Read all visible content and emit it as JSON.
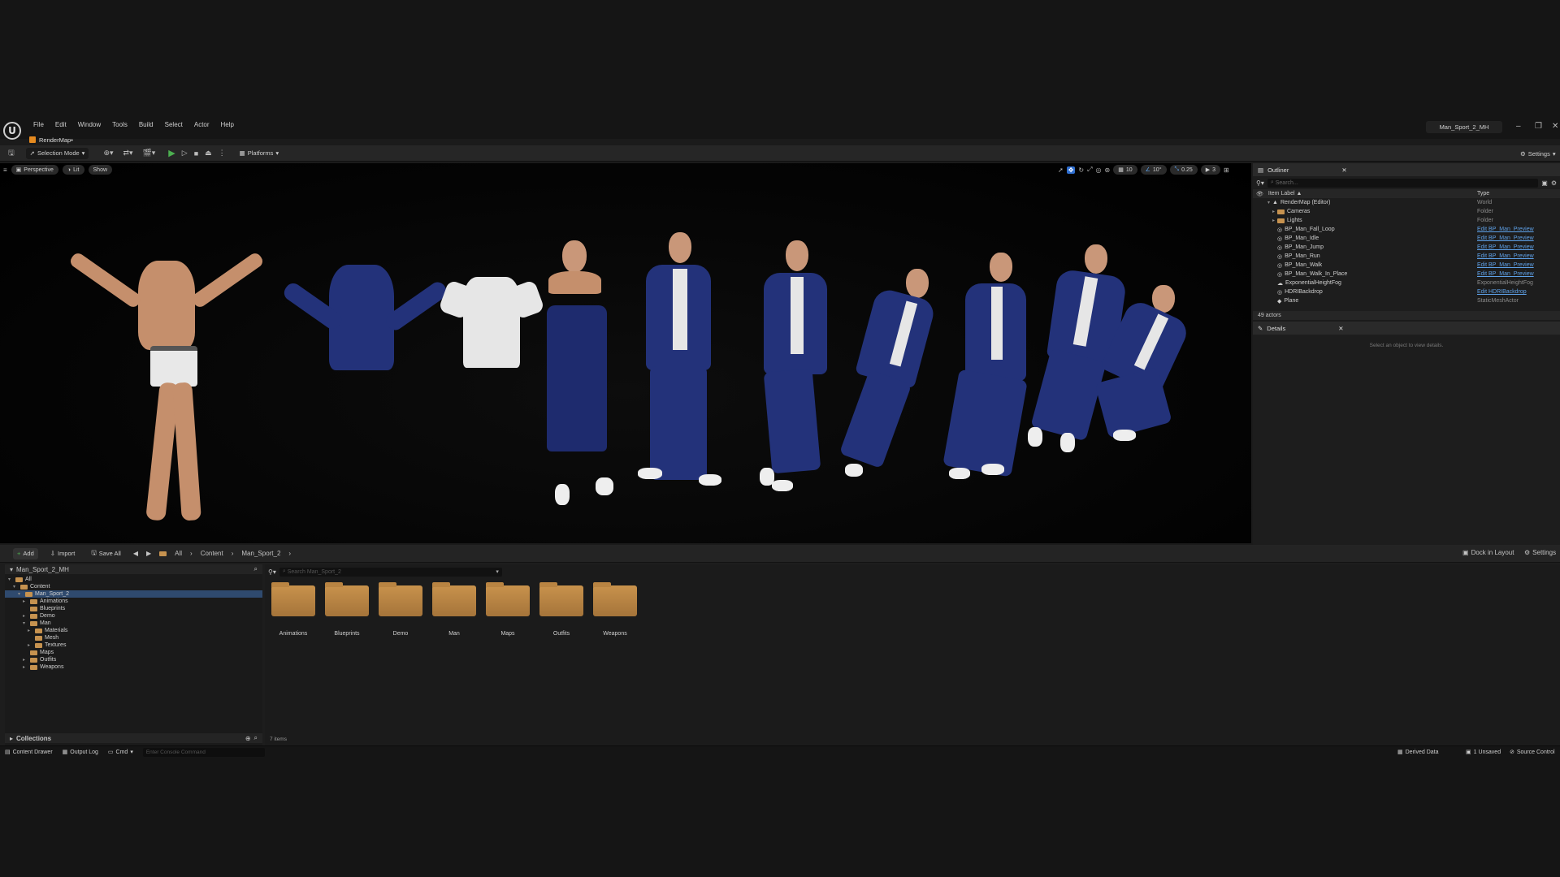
{
  "menubar": {
    "items": [
      "File",
      "Edit",
      "Window",
      "Tools",
      "Build",
      "Select",
      "Actor",
      "Help"
    ],
    "project_title": "Man_Sport_2_MH"
  },
  "document_tab": {
    "label": "RenderMap•"
  },
  "toolbar": {
    "selection_mode": "Selection Mode",
    "platforms": "Platforms",
    "settings": "Settings"
  },
  "viewport": {
    "perspective": "Perspective",
    "lit": "Lit",
    "show": "Show",
    "grid_snap": "10",
    "rotation_snap": "10°",
    "scale_snap": "0.25",
    "camera_speed": "3"
  },
  "outliner": {
    "tab": "Outliner",
    "search_placeholder": "Search...",
    "col_label": "Item Label ▲",
    "col_type": "Type",
    "rows": [
      {
        "label": "RenderMap (Editor)",
        "type": "World"
      },
      {
        "label": "Cameras",
        "type": "Folder"
      },
      {
        "label": "Lights",
        "type": "Folder"
      },
      {
        "label": "BP_Man_Fall_Loop",
        "type": "Edit BP_Man_Preview"
      },
      {
        "label": "BP_Man_Idle",
        "type": "Edit BP_Man_Preview"
      },
      {
        "label": "BP_Man_Jump",
        "type": "Edit BP_Man_Preview"
      },
      {
        "label": "BP_Man_Run",
        "type": "Edit BP_Man_Preview"
      },
      {
        "label": "BP_Man_Walk",
        "type": "Edit BP_Man_Preview"
      },
      {
        "label": "BP_Man_Walk_In_Place",
        "type": "Edit BP_Man_Preview"
      },
      {
        "label": "ExponentialHeightFog",
        "type": "ExponentialHeightFog"
      },
      {
        "label": "HDRIBackdrop",
        "type": "Edit HDRIBackdrop"
      },
      {
        "label": "Plane",
        "type": "StaticMeshActor"
      }
    ],
    "actor_count": "49 actors"
  },
  "details": {
    "tab": "Details",
    "empty_text": "Select an object to view details."
  },
  "content_browser": {
    "add": "Add",
    "import": "Import",
    "save_all": "Save All",
    "path": [
      "All",
      "Content",
      "Man_Sport_2"
    ],
    "dock": "Dock in Layout",
    "settings": "Settings",
    "tree_header": "Man_Sport_2_MH",
    "tree": [
      {
        "label": "All",
        "depth": 0
      },
      {
        "label": "Content",
        "depth": 1
      },
      {
        "label": "Man_Sport_2",
        "depth": 2
      },
      {
        "label": "Animations",
        "depth": 3
      },
      {
        "label": "Blueprints",
        "depth": 3
      },
      {
        "label": "Demo",
        "depth": 3
      },
      {
        "label": "Man",
        "depth": 3
      },
      {
        "label": "Materials",
        "depth": 4
      },
      {
        "label": "Mesh",
        "depth": 4
      },
      {
        "label": "Textures",
        "depth": 4
      },
      {
        "label": "Maps",
        "depth": 3
      },
      {
        "label": "Outfits",
        "depth": 3
      },
      {
        "label": "Weapons",
        "depth": 3
      }
    ],
    "collections": "Collections",
    "search_placeholder": "Search Man_Sport_2",
    "folders": [
      "Animations",
      "Blueprints",
      "Demo",
      "Man",
      "Maps",
      "Outfits",
      "Weapons"
    ],
    "item_count": "7 items"
  },
  "statusbar": {
    "content_drawer": "Content Drawer",
    "output_log": "Output Log",
    "cmd": "Cmd",
    "console_placeholder": "Enter Console Command",
    "derived_data": "Derived Data",
    "unsaved": "1 Unsaved",
    "source_control": "Source Control"
  },
  "colors": {
    "accent_blue": "#5ea1e8",
    "folder": "#c6924f",
    "play_green": "#4caf50"
  }
}
